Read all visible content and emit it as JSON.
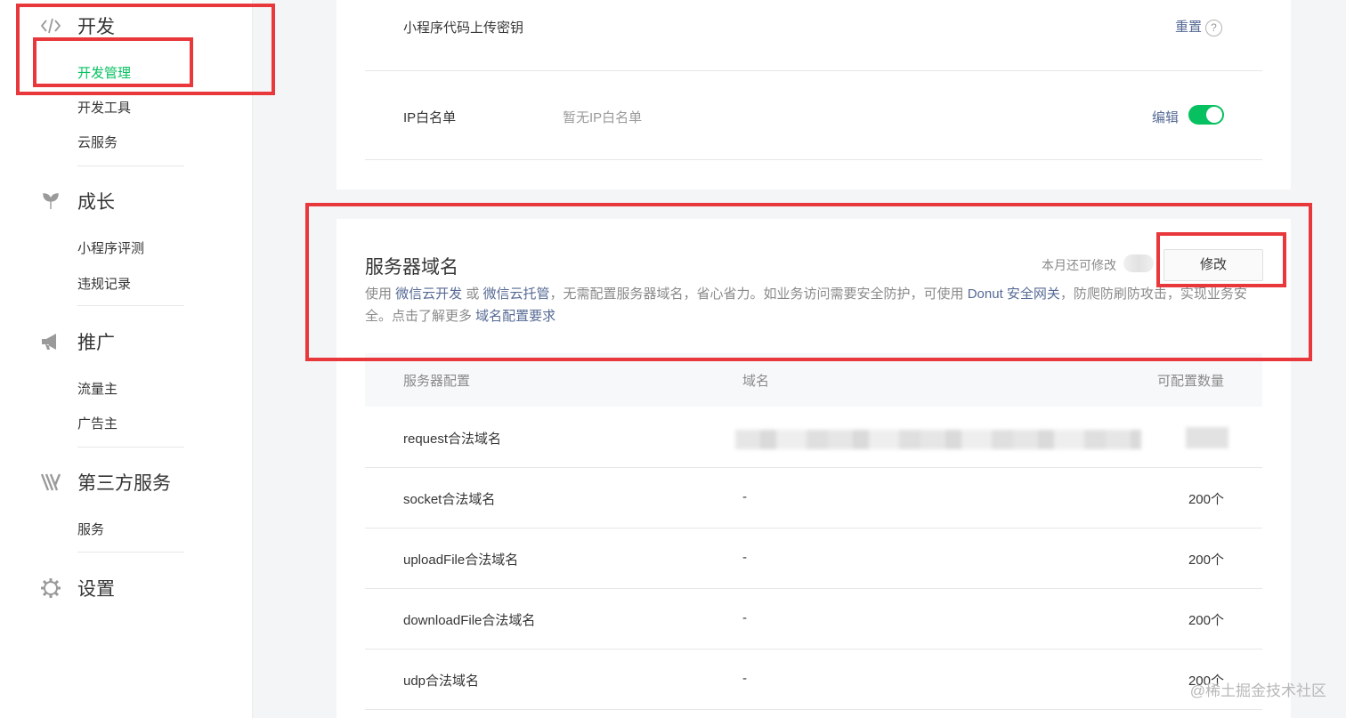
{
  "sidebar": {
    "groups": [
      {
        "title": "开发",
        "icon": "code-icon",
        "items": [
          "开发管理",
          "开发工具",
          "云服务"
        ],
        "active_index": 0
      },
      {
        "title": "成长",
        "icon": "sprout-icon",
        "items": [
          "小程序评测",
          "违规记录"
        ]
      },
      {
        "title": "推广",
        "icon": "megaphone-icon",
        "items": [
          "流量主",
          "广告主"
        ]
      },
      {
        "title": "第三方服务",
        "icon": "third-party-icon",
        "items": [
          "服务"
        ]
      },
      {
        "title": "设置",
        "icon": "gear-icon",
        "items": []
      }
    ]
  },
  "dev_settings": {
    "upload_key_label": "小程序代码上传密钥",
    "upload_key_action": "重置",
    "ip_whitelist_label": "IP白名单",
    "ip_whitelist_value": "暂无IP白名单",
    "ip_whitelist_action": "编辑",
    "ip_whitelist_enabled": true
  },
  "server_domain": {
    "title": "服务器域名",
    "quota_text": "本月还可修改",
    "edit_button": "修改",
    "desc": {
      "p1": "使用 ",
      "link1": "微信云开发",
      "p2": " 或 ",
      "link2": "微信云托管",
      "p3": "，无需配置服务器域名，省心省力。如业务访问需要安全防护，可使用 ",
      "link3": "Donut 安全网关",
      "p4": "，防爬防刷防攻击，实现业务安全。点击了解更多 ",
      "link4": "域名配置要求"
    },
    "table": {
      "headers": [
        "服务器配置",
        "域名",
        "可配置数量"
      ],
      "rows": [
        {
          "name": "request合法域名",
          "domain": "",
          "count": ""
        },
        {
          "name": "socket合法域名",
          "domain": "-",
          "count": "200个"
        },
        {
          "name": "uploadFile合法域名",
          "domain": "-",
          "count": "200个"
        },
        {
          "name": "downloadFile合法域名",
          "domain": "-",
          "count": "200个"
        },
        {
          "name": "udp合法域名",
          "domain": "-",
          "count": "200个"
        }
      ]
    }
  },
  "watermark": "@稀土掘金技术社区",
  "colors": {
    "accent_green": "#07c160",
    "link_blue": "#576b95",
    "annotation_red": "#e8383b"
  }
}
